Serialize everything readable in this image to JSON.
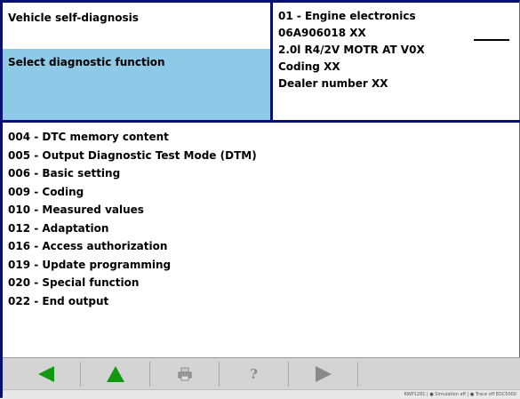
{
  "header": {
    "title": "Vehicle self-diagnosis",
    "instruction": "Select diagnostic function",
    "ecu_name": "01 - Engine electronics",
    "part_number": "06A906018 XX",
    "engine": "2.0l R4/2V  MOTR AT V0X",
    "coding": "Coding XX",
    "dealer": "Dealer number XX"
  },
  "functions": [
    "004 - DTC memory content",
    "005 - Output Diagnostic Test Mode (DTM)",
    "006 - Basic setting",
    "009 - Coding",
    "010 - Measured values",
    "012 - Adaptation",
    "016 - Access authorization",
    "019 - Update programming",
    "020 - Special function",
    "022 - End output"
  ],
  "toolbar": {
    "help_label": "?",
    "icons": [
      "back-arrow-icon",
      "up-arrow-icon",
      "printer-icon",
      "help-icon",
      "forward-arrow-icon"
    ],
    "accent_color": "#119911",
    "disabled_color": "#8a8a8a"
  },
  "status": {
    "text": "KWP1281 | ● Simulation aff | ● Trace off  EDC5000"
  },
  "colors": {
    "border": "#0a1070",
    "selected_bg": "#8ec9e7",
    "toolbar_bg": "#d4d4d4"
  }
}
